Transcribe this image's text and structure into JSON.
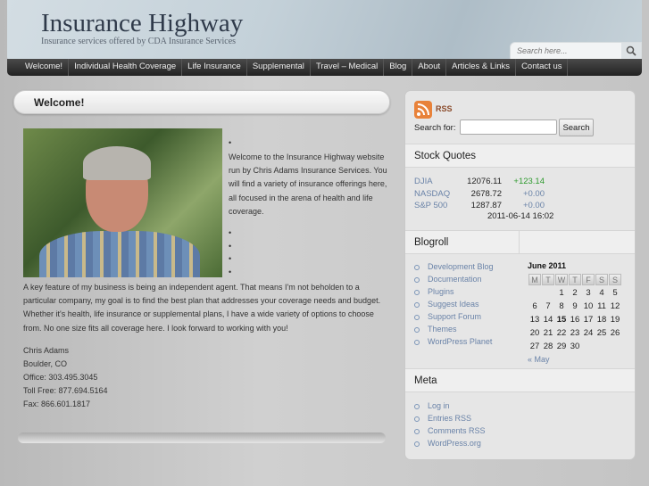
{
  "header": {
    "title": "Insurance Highway",
    "tagline": "Insurance services offered by CDA Insurance Services",
    "search_placeholder": "Search here..."
  },
  "nav": [
    "Welcome!",
    "Individual Health Coverage",
    "Life Insurance",
    "Supplemental",
    "Travel – Medical",
    "Blog",
    "About",
    "Articles & Links",
    "Contact us"
  ],
  "main": {
    "title": "Welcome!",
    "intro": "Welcome to the Insurance Highway website run by Chris Adams Insurance Services.  You will find a variety of insurance offerings here, all focused in the arena of health and life coverage.",
    "paragraph": "A key feature of my business is being an independent agent.  That means I'm not beholden to a particular company, my goal is to find the best plan that addresses your coverage needs and budget.  Whether it's health, life insurance or supplemental plans, I have a wide variety of options to choose from.  No one size fits all coverage here. I look forward to working with you!",
    "contact": [
      "Chris Adams",
      "Boulder, CO",
      "Office: 303.495.3045",
      "Toll Free: 877.694.5164",
      "Fax:  866.601.1817"
    ]
  },
  "sidebar": {
    "rss_label": "RSS",
    "search_label": "Search for:",
    "search_value": "",
    "search_button": "Search",
    "stock_title": "Stock Quotes",
    "stocks": [
      {
        "name": "DJIA",
        "value": "12076.11",
        "change": "+123.14"
      },
      {
        "name": "NASDAQ",
        "value": "2678.72",
        "change": "+0.00"
      },
      {
        "name": "S&P 500",
        "value": "1287.87",
        "change": "+0.00"
      }
    ],
    "stock_time": "2011-06-14 16:02",
    "blogroll_title": "Blogroll",
    "blogroll": [
      "Development Blog",
      "Documentation",
      "Plugins",
      "Suggest Ideas",
      "Support Forum",
      "Themes",
      "WordPress Planet"
    ],
    "calendar": {
      "caption": "June 2011",
      "days": [
        "M",
        "T",
        "W",
        "T",
        "F",
        "S",
        "S"
      ],
      "weeks": [
        [
          "",
          "",
          "1",
          "2",
          "3",
          "4",
          "5"
        ],
        [
          "6",
          "7",
          "8",
          "9",
          "10",
          "11",
          "12"
        ],
        [
          "13",
          "14",
          "15",
          "16",
          "17",
          "18",
          "19"
        ],
        [
          "20",
          "21",
          "22",
          "23",
          "24",
          "25",
          "26"
        ],
        [
          "27",
          "28",
          "29",
          "30",
          "",
          "",
          ""
        ]
      ],
      "today": "15",
      "prev": "« May"
    },
    "meta_title": "Meta",
    "meta": [
      "Log in",
      "Entries RSS",
      "Comments RSS",
      "WordPress.org"
    ]
  },
  "colors": {
    "positive": "#2e9a2e",
    "link": "#6a83a8",
    "nav_bg": "#2a2a2a"
  }
}
